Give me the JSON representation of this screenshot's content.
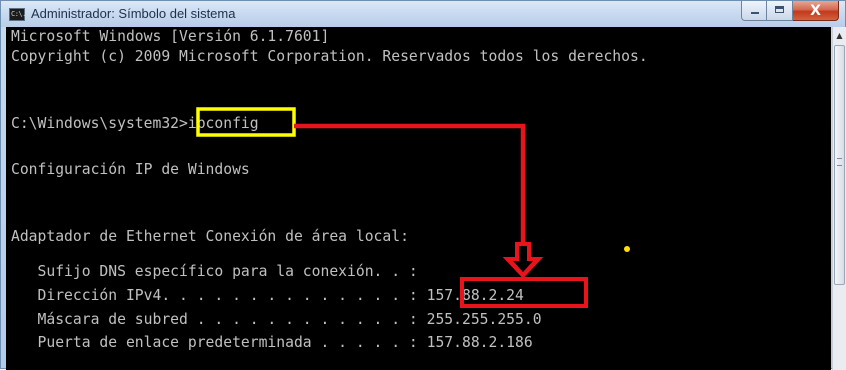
{
  "window": {
    "title": "Administrador: Símbolo del sistema",
    "icon_label": "C:\\.",
    "close_glyph": "X"
  },
  "console": {
    "lines": [
      "Microsoft Windows [Versión 6.1.7601]",
      "Copyright (c) 2009 Microsoft Corporation. Reservados todos los derechos.",
      "",
      "C:\\Windows\\system32>ipconfig",
      "",
      "Configuración IP de Windows",
      "",
      "",
      "Adaptador de Ethernet Conexión de área local:",
      "",
      "   Sufijo DNS específico para la conexión. . :",
      "   Dirección IPv4. . . . . . . . . . . . . . : 157.88.2.24",
      "   Máscara de subred . . . . . . . . . . . . : 255.255.255.0",
      "   Puerta de enlace predeterminada . . . . . : 157.88.2.186"
    ]
  },
  "annotations": {
    "highlight_color": "#ffff00",
    "arrow_color": "#e8141b",
    "dot_color": "#ffe000"
  },
  "icons": {
    "window_icon": "cmd-icon",
    "minimize": "minimize-icon",
    "maximize": "maximize-icon",
    "close": "close-icon",
    "scroll_up": "scroll-up-arrow-icon"
  }
}
